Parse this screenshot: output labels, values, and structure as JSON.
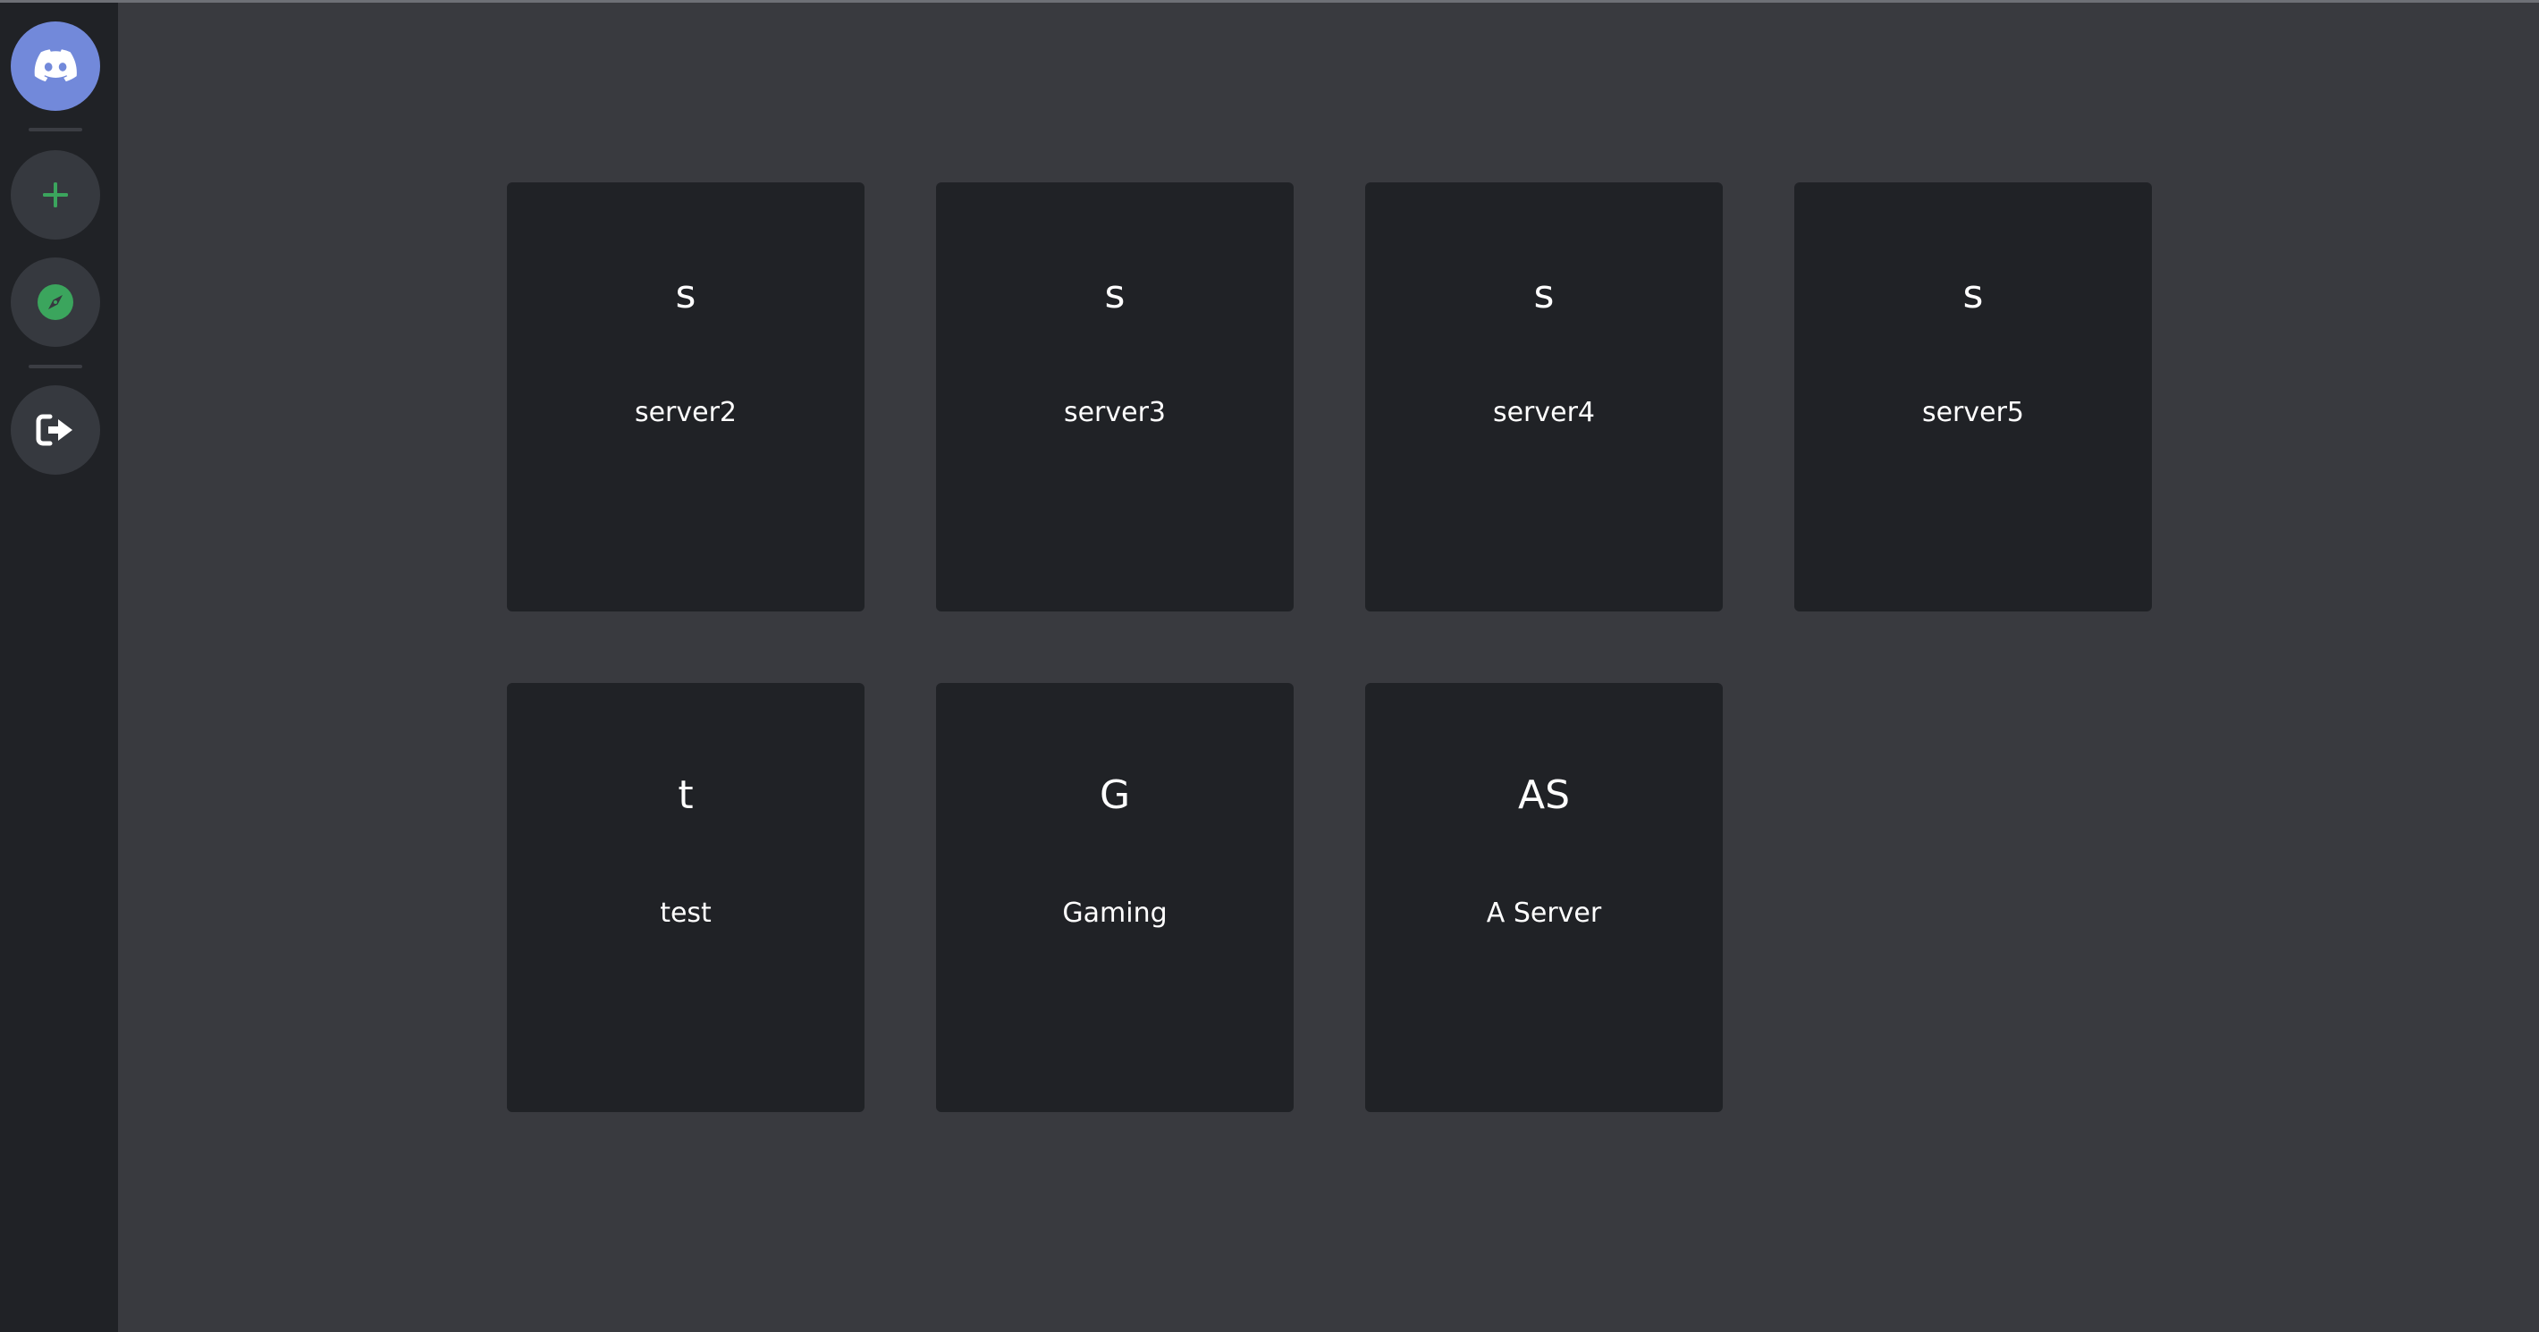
{
  "sidebar": {
    "home_icon": "discord-logo-icon",
    "add_server_icon": "plus-icon",
    "explore_icon": "compass-icon",
    "logout_icon": "logout-icon",
    "colors": {
      "home_bg": "#7289da",
      "accent_green": "#3ba55d",
      "button_bg": "#36393f"
    }
  },
  "servers": [
    {
      "initials": "s",
      "name": "server2"
    },
    {
      "initials": "s",
      "name": "server3"
    },
    {
      "initials": "s",
      "name": "server4"
    },
    {
      "initials": "s",
      "name": "server5"
    },
    {
      "initials": "t",
      "name": "test"
    },
    {
      "initials": "G",
      "name": "Gaming"
    },
    {
      "initials": "AS",
      "name": "A Server"
    }
  ]
}
